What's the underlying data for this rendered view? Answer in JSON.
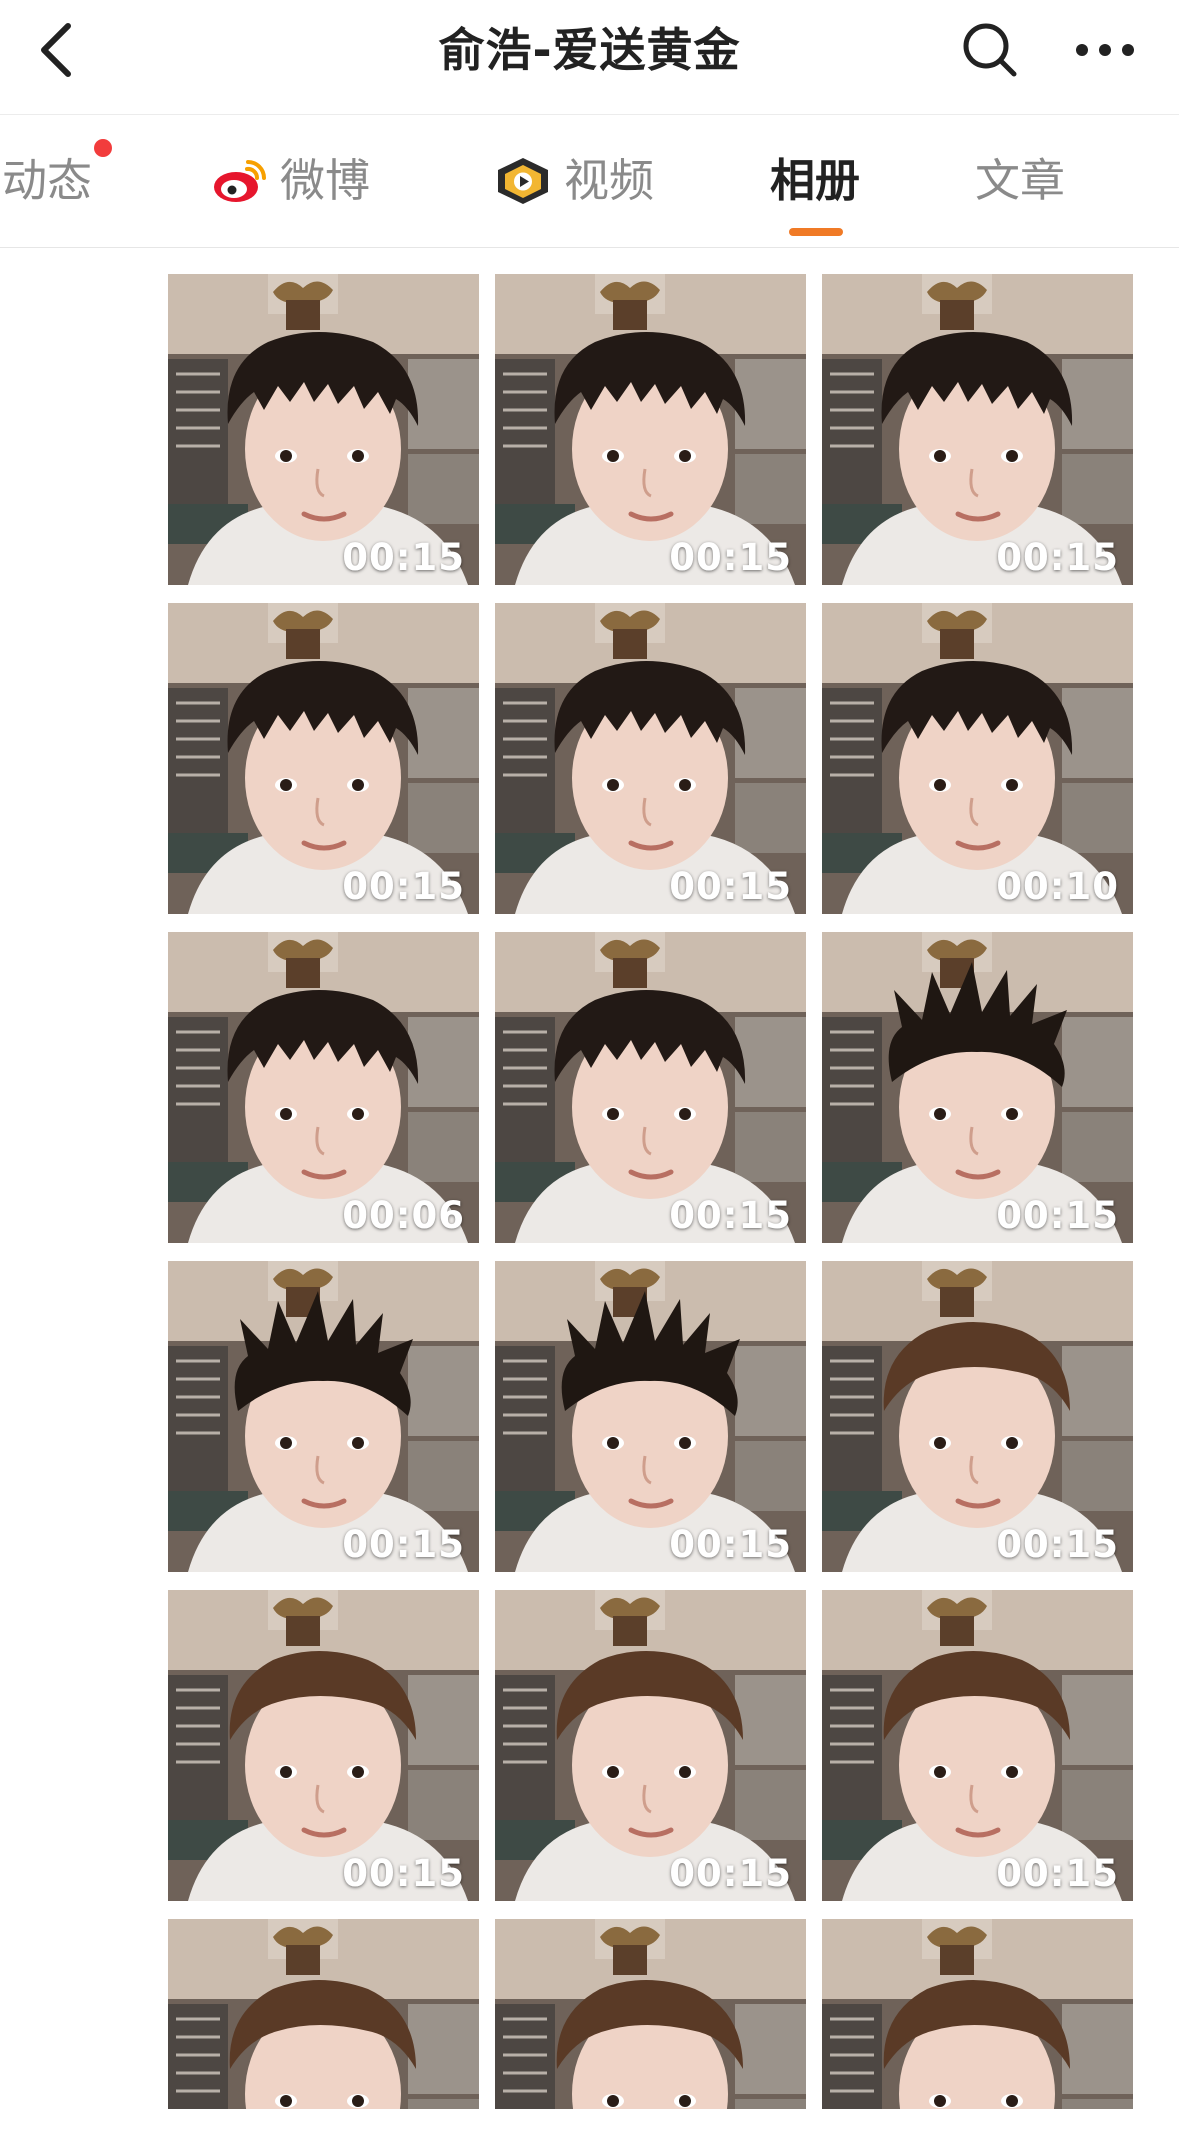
{
  "header": {
    "title": "俞浩-爱送黄金",
    "back_icon": "chevron-left-icon",
    "search_icon": "search-icon",
    "more_icon": "more-dots-icon"
  },
  "tabs": [
    {
      "label": "动态",
      "icon": "",
      "badge": "red-dot",
      "active": false
    },
    {
      "label": "微博",
      "icon": "weibo-icon",
      "active": false
    },
    {
      "label": "视频",
      "icon": "video-icon",
      "active": false
    },
    {
      "label": "相册",
      "icon": "",
      "active": true
    },
    {
      "label": "文章",
      "icon": "",
      "active": false
    }
  ],
  "colors": {
    "accent": "#f07a26",
    "badge": "#f23c3c",
    "text_primary": "#222222",
    "text_secondary": "#8a8a8a"
  },
  "album": {
    "items": [
      {
        "duration": "00:15",
        "hair": "neat"
      },
      {
        "duration": "00:15",
        "hair": "neat"
      },
      {
        "duration": "00:15",
        "hair": "neat"
      },
      {
        "duration": "00:15",
        "hair": "neat"
      },
      {
        "duration": "00:15",
        "hair": "neat"
      },
      {
        "duration": "00:10",
        "hair": "neat"
      },
      {
        "duration": "00:06",
        "hair": "neat"
      },
      {
        "duration": "00:15",
        "hair": "neat"
      },
      {
        "duration": "00:15",
        "hair": "spiky"
      },
      {
        "duration": "00:15",
        "hair": "spiky"
      },
      {
        "duration": "00:15",
        "hair": "spiky"
      },
      {
        "duration": "00:15",
        "hair": "brown"
      },
      {
        "duration": "00:15",
        "hair": "brown"
      },
      {
        "duration": "00:15",
        "hair": "brown"
      },
      {
        "duration": "00:15",
        "hair": "brown"
      },
      {
        "duration": "",
        "hair": "brown"
      },
      {
        "duration": "",
        "hair": "brown"
      },
      {
        "duration": "",
        "hair": "brown"
      }
    ]
  }
}
